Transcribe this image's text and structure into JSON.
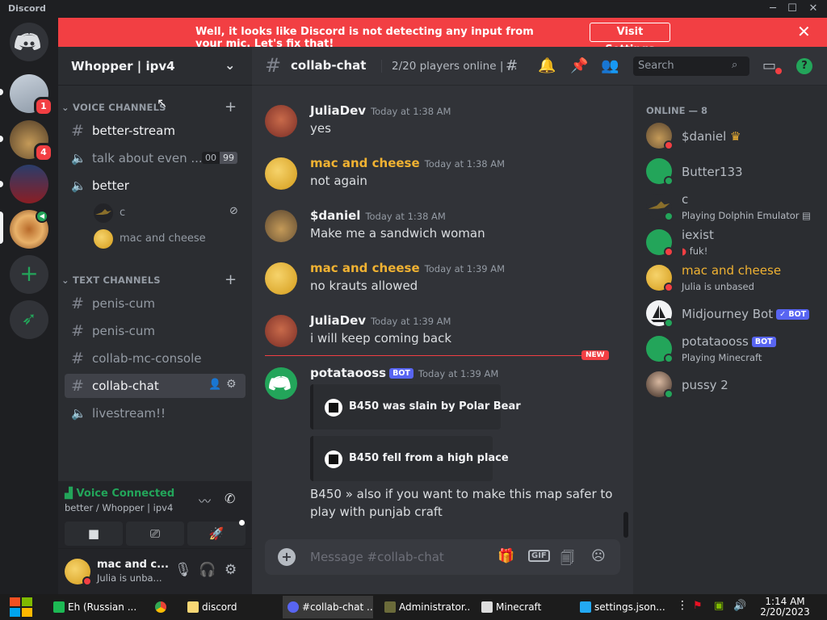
{
  "window": {
    "title": "Discord"
  },
  "servers": {
    "badges": [
      "1",
      "4"
    ]
  },
  "banner": {
    "message": "Well, it looks like Discord is not detecting any input from your mic. Let's fix that!",
    "button": "Visit Settings"
  },
  "guild": {
    "name": "Whopper | ipv4"
  },
  "voice_category": "VOICE CHANNELS",
  "voice_channels": [
    {
      "name": "better-stream"
    },
    {
      "name": "talk about even ...",
      "count_a": "00",
      "count_b": "99"
    },
    {
      "name": "better"
    }
  ],
  "voice_users": [
    "c",
    "mac and cheese"
  ],
  "text_category": "TEXT CHANNELS",
  "text_channels": [
    "penis-cum",
    "penis-cum",
    "collab-mc-console",
    "collab-chat",
    "livestream!!"
  ],
  "voice_connected": {
    "title": "Voice Connected",
    "subtitle": "better / Whopper | ipv4"
  },
  "user_panel": {
    "name": "mac and c...",
    "status": "Julia is unba..."
  },
  "chat_header": {
    "channel": "collab-chat",
    "topic": "2/20 players online | ...",
    "search_placeholder": "Search"
  },
  "messages": [
    {
      "author": "JuliaDev",
      "time": "Today at 1:38 AM",
      "text": "yes"
    },
    {
      "author": "mac and cheese",
      "time": "Today at 1:38 AM",
      "text": "not again"
    },
    {
      "author": "$daniel",
      "time": "Today at 1:38 AM",
      "text": "Make me a sandwich woman"
    },
    {
      "author": "mac and cheese",
      "time": "Today at 1:39 AM",
      "text": "no krauts allowed"
    },
    {
      "author": "JuliaDev",
      "time": "Today at 1:39 AM",
      "text": "i will keep coming back"
    },
    {
      "author": "potataooss",
      "bot_tag": "BOT",
      "time": "Today at 1:39 AM",
      "text_1": "B450 » also if you want to make this map safer to",
      "text_2": "play with punjab craft"
    }
  ],
  "embeds": [
    "B450 was slain by Polar Bear",
    "B450 fell from a high place"
  ],
  "new_marker": "NEW",
  "composer": {
    "placeholder": "Message #collab-chat",
    "gif": "GIF"
  },
  "members_header": "ONLINE — 8",
  "members": [
    {
      "name": "$daniel",
      "activity": ""
    },
    {
      "name": "Butter133",
      "activity": ""
    },
    {
      "name": "c",
      "activity": "Playing Dolphin Emulator"
    },
    {
      "name": "iexist",
      "activity": "fuk!"
    },
    {
      "name": "mac and cheese",
      "activity": "Julia is unbased"
    },
    {
      "name": "Midjourney Bot",
      "tag": "✓ BOT",
      "activity": ""
    },
    {
      "name": "potataooss",
      "tag": "BOT",
      "activity": "Playing Minecraft"
    },
    {
      "name": "pussy 2",
      "activity": ""
    }
  ],
  "taskbar": {
    "items": [
      "Eh (Russian ...",
      "discord",
      "#collab-chat ...",
      "Administrator...",
      "Minecraft",
      "settings.json..."
    ],
    "time": "1:14 AM",
    "date": "2/20/2023"
  },
  "colors": {
    "blurple": "#5865f2",
    "red": "#f23f43",
    "green": "#23a55a",
    "yellow": "#f0b232"
  }
}
